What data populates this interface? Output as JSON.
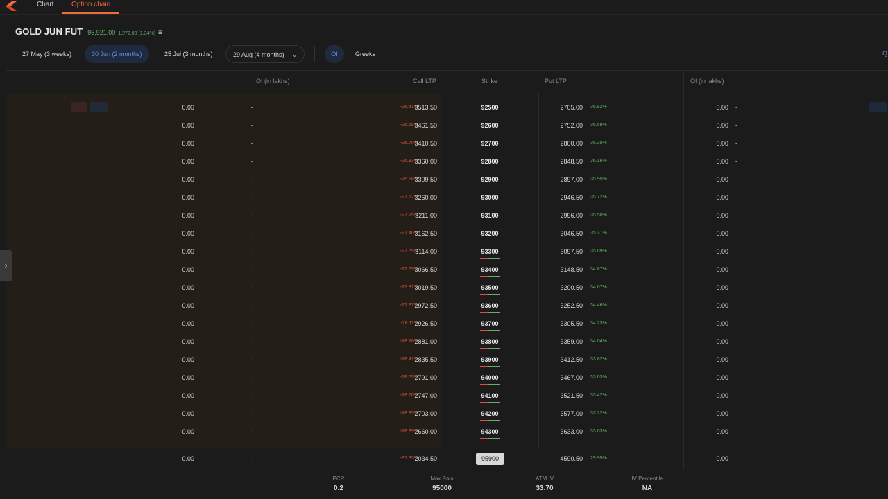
{
  "tabs": [
    {
      "label": "Chart",
      "active": false
    },
    {
      "label": "Option chain",
      "active": true
    }
  ],
  "instrument": {
    "name": "GOLD JUN FUT",
    "ltp": "95,921.00",
    "change": "1,272.00 (1.34%)"
  },
  "expiries": [
    {
      "label": "27 May (3 weeks)",
      "selected": false
    },
    {
      "label": "30 Jun (2 months)",
      "selected": true
    },
    {
      "label": "25 Jul (3 months)",
      "selected": false
    },
    {
      "label": "29 Aug (4 months)",
      "selected": false
    }
  ],
  "view_toggle": {
    "oi": "OI",
    "greeks": "Greeks",
    "selected": "OI"
  },
  "edge_link": "Q",
  "headers": {
    "oi_call": "OI (in lakhs)",
    "call_ltp": "Call LTP",
    "strike": "Strike",
    "put_ltp": "Put LTP",
    "oi_put": "OI (in lakhs)"
  },
  "rows": [
    {
      "call_oi": "0.00",
      "call_oi_chg": "-",
      "call_chg": "-26.41%",
      "call_ltp": "3513.50",
      "strike": "92500",
      "put_ltp": "2705.00",
      "put_chg": "36.82%",
      "put_oi": "0.00",
      "put_oi_chg": "-"
    },
    {
      "call_oi": "0.00",
      "call_oi_chg": "-",
      "call_chg": "-26.55%",
      "call_ltp": "3461.50",
      "strike": "92600",
      "put_ltp": "2752.00",
      "put_chg": "36.58%",
      "put_oi": "0.00",
      "put_oi_chg": "-"
    },
    {
      "call_oi": "0.00",
      "call_oi_chg": "-",
      "call_chg": "-26.70%",
      "call_ltp": "3410.50",
      "strike": "92700",
      "put_ltp": "2800.00",
      "put_chg": "36.35%",
      "put_oi": "0.00",
      "put_oi_chg": "-"
    },
    {
      "call_oi": "0.00",
      "call_oi_chg": "-",
      "call_chg": "-26.83%",
      "call_ltp": "3360.00",
      "strike": "92800",
      "put_ltp": "2848.50",
      "put_chg": "36.16%",
      "put_oi": "0.00",
      "put_oi_chg": "-"
    },
    {
      "call_oi": "0.00",
      "call_oi_chg": "-",
      "call_chg": "-26.98%",
      "call_ltp": "3309.50",
      "strike": "92900",
      "put_ltp": "2897.00",
      "put_chg": "35.95%",
      "put_oi": "0.00",
      "put_oi_chg": "-"
    },
    {
      "call_oi": "0.00",
      "call_oi_chg": "-",
      "call_chg": "-27.12%",
      "call_ltp": "3260.00",
      "strike": "93000",
      "put_ltp": "2946.50",
      "put_chg": "35.72%",
      "put_oi": "0.00",
      "put_oi_chg": "-"
    },
    {
      "call_oi": "0.00",
      "call_oi_chg": "-",
      "call_chg": "-27.25%",
      "call_ltp": "3211.00",
      "strike": "93100",
      "put_ltp": "2996.00",
      "put_chg": "35.50%",
      "put_oi": "0.00",
      "put_oi_chg": "-"
    },
    {
      "call_oi": "0.00",
      "call_oi_chg": "-",
      "call_chg": "-27.40%",
      "call_ltp": "3162.50",
      "strike": "93200",
      "put_ltp": "3046.50",
      "put_chg": "35.31%",
      "put_oi": "0.00",
      "put_oi_chg": "-"
    },
    {
      "call_oi": "0.00",
      "call_oi_chg": "-",
      "call_chg": "-27.55%",
      "call_ltp": "3114.00",
      "strike": "93300",
      "put_ltp": "3097.50",
      "put_chg": "35.09%",
      "put_oi": "0.00",
      "put_oi_chg": "-"
    },
    {
      "call_oi": "0.00",
      "call_oi_chg": "-",
      "call_chg": "-27.69%",
      "call_ltp": "3066.50",
      "strike": "93400",
      "put_ltp": "3148.50",
      "put_chg": "34.87%",
      "put_oi": "0.00",
      "put_oi_chg": "-"
    },
    {
      "call_oi": "0.00",
      "call_oi_chg": "-",
      "call_chg": "-27.82%",
      "call_ltp": "3019.50",
      "strike": "93500",
      "put_ltp": "3200.50",
      "put_chg": "34.67%",
      "put_oi": "0.00",
      "put_oi_chg": "-"
    },
    {
      "call_oi": "0.00",
      "call_oi_chg": "-",
      "call_chg": "-27.97%",
      "call_ltp": "2972.50",
      "strike": "93600",
      "put_ltp": "3252.50",
      "put_chg": "34.46%",
      "put_oi": "0.00",
      "put_oi_chg": "-"
    },
    {
      "call_oi": "0.00",
      "call_oi_chg": "-",
      "call_chg": "-28.11%",
      "call_ltp": "2926.50",
      "strike": "93700",
      "put_ltp": "3305.50",
      "put_chg": "34.23%",
      "put_oi": "0.00",
      "put_oi_chg": "-"
    },
    {
      "call_oi": "0.00",
      "call_oi_chg": "-",
      "call_chg": "-28.26%",
      "call_ltp": "2881.00",
      "strike": "93800",
      "put_ltp": "3359.00",
      "put_chg": "34.04%",
      "put_oi": "0.00",
      "put_oi_chg": "-"
    },
    {
      "call_oi": "0.00",
      "call_oi_chg": "-",
      "call_chg": "-28.41%",
      "call_ltp": "2835.50",
      "strike": "93900",
      "put_ltp": "3412.50",
      "put_chg": "33.82%",
      "put_oi": "0.00",
      "put_oi_chg": "-"
    },
    {
      "call_oi": "0.00",
      "call_oi_chg": "-",
      "call_chg": "-28.55%",
      "call_ltp": "2791.00",
      "strike": "94000",
      "put_ltp": "3467.00",
      "put_chg": "33.63%",
      "put_oi": "0.00",
      "put_oi_chg": "-"
    },
    {
      "call_oi": "0.00",
      "call_oi_chg": "-",
      "call_chg": "-28.70%",
      "call_ltp": "2747.00",
      "strike": "94100",
      "put_ltp": "3521.50",
      "put_chg": "33.42%",
      "put_oi": "0.00",
      "put_oi_chg": "-"
    },
    {
      "call_oi": "0.00",
      "call_oi_chg": "-",
      "call_chg": "-28.85%",
      "call_ltp": "2703.00",
      "strike": "94200",
      "put_ltp": "3577.00",
      "put_chg": "33.22%",
      "put_oi": "0.00",
      "put_oi_chg": "-"
    },
    {
      "call_oi": "0.00",
      "call_oi_chg": "-",
      "call_chg": "-28.99%",
      "call_ltp": "2660.00",
      "strike": "94300",
      "put_ltp": "3633.00",
      "put_chg": "33.03%",
      "put_oi": "0.00",
      "put_oi_chg": "-"
    }
  ],
  "spot_row": {
    "call_oi": "0.00",
    "call_oi_chg": "-",
    "call_chg": "-31.35%",
    "call_ltp": "2034.50",
    "strike": "95900",
    "put_ltp": "4590.50",
    "put_chg": "29.95%",
    "put_oi": "0.00",
    "put_oi_chg": "-"
  },
  "footer": [
    {
      "label": "PCR",
      "value": "0.2"
    },
    {
      "label": "Max Pain",
      "value": "95000"
    },
    {
      "label": "ATM IV",
      "value": "33.70"
    },
    {
      "label": "IV Percentile",
      "value": "NA"
    }
  ],
  "colors": {
    "background": "#1b1b1b",
    "accent": "#f06a3f",
    "selected_chip": "#5d8cdc",
    "positive": "#5fb266",
    "negative": "#d9543f",
    "itm_shade": "#241e19"
  },
  "icons": {
    "logo": "kite-logo-icon",
    "menu": "hamburger-icon",
    "chevron": "chevron-down-icon",
    "side_handle": "chevron-right-icon"
  }
}
